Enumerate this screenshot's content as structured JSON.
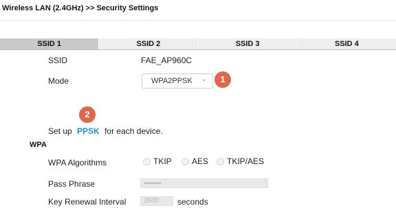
{
  "header": {
    "title": "Wireless LAN (2.4GHz) >> Security Settings"
  },
  "tabs": [
    {
      "label": "SSID 1",
      "active": true
    },
    {
      "label": "SSID 2",
      "active": false
    },
    {
      "label": "SSID 3",
      "active": false
    },
    {
      "label": "SSID 4",
      "active": false
    }
  ],
  "form": {
    "ssid_label": "SSID",
    "ssid_value": "FAE_AP960C",
    "mode_label": "Mode",
    "mode_value": "WPA2PPSK",
    "setup_prefix": "Set up",
    "setup_link": "PPSK",
    "setup_suffix": "for each device.",
    "wpa_section": "WPA",
    "wpa_algorithms_label": "WPA Algorithms",
    "algorithms": [
      "TKIP",
      "AES",
      "TKIP/AES"
    ],
    "pass_phrase_label": "Pass Phrase",
    "pass_phrase_value": "••••••••",
    "key_renewal_label": "Key Renewal Interval",
    "key_renewal_value": "3600",
    "key_renewal_unit": "seconds"
  },
  "badges": {
    "one": "1",
    "two": "2"
  },
  "colors": {
    "badge": "#e0684a",
    "link": "#1a94d1",
    "active_tab": "#c9c9c9",
    "inactive_tab": "#eeeeee"
  }
}
